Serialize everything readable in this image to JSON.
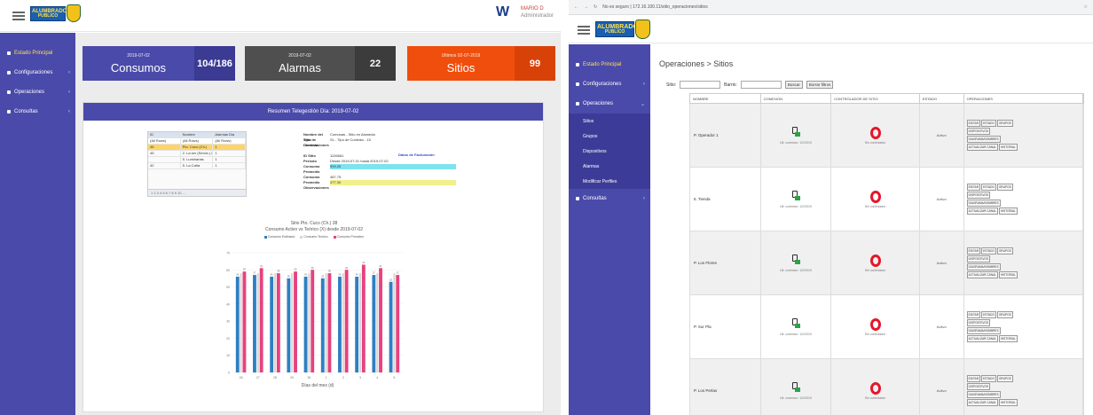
{
  "left": {
    "logo": {
      "line1": "ALUMBRADO",
      "line2": "PUBLICO"
    },
    "user": {
      "name": "MARIO D",
      "sub": "Administrador"
    },
    "sidebar": {
      "items": [
        {
          "label": "Estado Principal",
          "active": true
        },
        {
          "label": "Configuraciones"
        },
        {
          "label": "Operaciones"
        },
        {
          "label": "Consultas"
        }
      ]
    },
    "cards": [
      {
        "date": "2019-07-02",
        "title": "Consumos",
        "value": "104/186",
        "color": "#4a4aaa",
        "num_color": "#3b3b94"
      },
      {
        "date": "2019-07-02",
        "title": "Alarmas",
        "value": "22",
        "color": "#4f4f4f",
        "num_color": "#3c3c3c"
      },
      {
        "date": "Ultimos 02-07-2019",
        "title": "Sitios",
        "value": "99",
        "color": "#f04e0c",
        "num_color": "#d84208"
      }
    ],
    "report": {
      "header": "Resumen Telegestión Día: 2019-07-02",
      "table": {
        "columns": [
          "ID",
          "Nombre",
          "Alarmas Dia"
        ],
        "filters": [
          "(All Rows)",
          "(All Rows)",
          "(All Rows)"
        ],
        "rows": [
          [
            "46",
            "Pto. Cuco (Ch.)",
            "1"
          ],
          [
            "45",
            "2. La ser (Servic.) Pl. Terru",
            "1"
          ],
          [
            "",
            "5. Luminarias",
            "1"
          ],
          [
            "42",
            "5. La Caña",
            "1"
          ]
        ],
        "pager": "1 2 3 4 5 6 7 8 9 10 ..."
      },
      "info": [
        {
          "k": "Nombre del Sitio",
          "v": "Comunas - Sitio en Alameda"
        },
        {
          "k": "Tipo de Contrato",
          "v": "SL - Tipo de Contrato - 15"
        },
        {
          "k": "Observaciones",
          "v": ""
        },
        {
          "k": "",
          "v": ""
        },
        {
          "k": "ID Sitio",
          "v": "1126661"
        },
        {
          "k": "Período",
          "v": "Desde 2019-07-01 hasta 2019-07-02"
        },
        {
          "k": "Consumo",
          "v": "999.25",
          "hl": "cy"
        },
        {
          "k": "Promedio",
          "v": ""
        },
        {
          "k": "Consumo",
          "v": "487.75"
        },
        {
          "k": "Promedio",
          "v": "477.30",
          "hl": "yw"
        },
        {
          "k": "Observaciones",
          "v": ""
        }
      ],
      "info_link": "Datos de Facturación",
      "chart_titles": [
        "Sitio Pto. Cuco (Ch.) 38",
        "Consumo Activo vs Teórico (X) desde 2019-07-02"
      ],
      "legend": [
        {
          "name": "Consumo Estimado",
          "color": "#2f7fc1"
        },
        {
          "name": "Consumo Teórico",
          "color": "#d7d7d7"
        },
        {
          "name": "Consumo Prorrateo",
          "color": "#e8417d"
        }
      ],
      "x_axis_label": "Días del mes (d)"
    }
  },
  "chart_data": {
    "type": "bar",
    "categories": [
      "26",
      "27",
      "28",
      "29",
      "30",
      "1",
      "2",
      "3",
      "4",
      "5"
    ],
    "series": [
      {
        "name": "Consumo Estimado",
        "values": [
          56,
          57,
          56,
          55,
          56,
          55,
          56,
          56,
          57,
          53
        ]
      },
      {
        "name": "Consumo Teórico",
        "values": [
          58,
          58,
          58,
          58,
          58,
          58,
          58,
          58,
          58,
          58
        ]
      },
      {
        "name": "Consumo Prorrateo",
        "values": [
          59,
          61,
          58,
          59,
          60,
          58,
          60,
          63,
          61,
          57
        ]
      }
    ],
    "ylim": [
      0,
      70
    ],
    "xlabel": "Días del mes (d)"
  },
  "colors": {
    "sidebar": "#4a4aaa",
    "card_blue": "#4a4aaa",
    "card_dark": "#4f4f4f",
    "card_orange": "#f04e0c",
    "bar_blue": "#2f7fc1",
    "bar_pink": "#e8417d",
    "bar_light": "#d7d7d7"
  },
  "right": {
    "address": "No es seguro | 172.16.100.11/sitio_operaciones/sitios",
    "logo": {
      "line1": "ALUMBRADO",
      "line2": "PUBLICO"
    },
    "sidebar": {
      "items": [
        {
          "label": "Estado Principal",
          "active": true
        },
        {
          "label": "Configuraciones"
        },
        {
          "label": "Operaciones",
          "open": true
        }
      ],
      "subitems": [
        "Sitios",
        "Grupos",
        "Dispositivos",
        "Alarmas",
        "Modificar Perfiles"
      ],
      "after": [
        {
          "label": "Consultas"
        }
      ]
    },
    "breadcrumb": "Operaciones > Sitios",
    "filters": {
      "sitio_label": "Sitio:",
      "barrio_label": "Barrio:",
      "search_button": "Buscar",
      "clear_button": "Borrar filtros"
    },
    "grid": {
      "columns": [
        "NOMBRE",
        "CONEXION",
        "CONTROLADOR DE SITIO",
        "ESTADO",
        "OPERACIONES"
      ],
      "rows": [
        {
          "name": "P. Operador 1",
          "status": "Activo"
        },
        {
          "name": "5. Tienda",
          "status": "Activo"
        },
        {
          "name": "P. Los Flores",
          "status": "Activo"
        },
        {
          "name": "P. Sur Pla",
          "status": "Activo"
        },
        {
          "name": "P. Los Perlas",
          "status": "Activo"
        }
      ],
      "conn_caption": "Ult. conexion: 1/2/2019",
      "ctrl_caption": "Sin controlador",
      "actions": [
        "EDITAR",
        "ESTADO",
        "GRUPOS",
        "DISPOSITIVOS",
        "DIAGRAMA/NOMBRES",
        "ACTUALIZAR CANAL",
        "HISTORIAL"
      ]
    }
  }
}
